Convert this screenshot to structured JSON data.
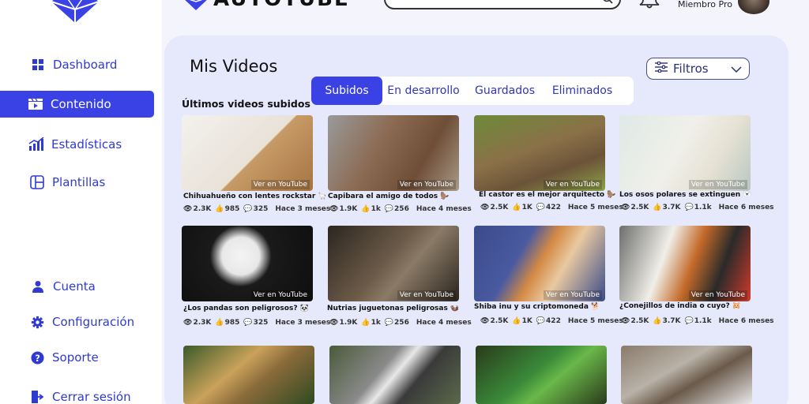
{
  "app": {
    "brand": "AUTOTUBE",
    "member_label": "Miembro Pro"
  },
  "sidebar": {
    "items": [
      {
        "label": "Dashboard",
        "icon": "grid-icon"
      },
      {
        "label": "Contenido",
        "icon": "clapperboard-icon",
        "active": true
      },
      {
        "label": "Estadísticas",
        "icon": "bar-chart-icon"
      },
      {
        "label": "Plantillas",
        "icon": "template-icon"
      }
    ],
    "bottom_items": [
      {
        "label": "Cuenta",
        "icon": "user-icon"
      },
      {
        "label": "Configuración",
        "icon": "gear-icon"
      },
      {
        "label": "Soporte",
        "icon": "help-icon"
      },
      {
        "label": "Cerrar sesión",
        "icon": "logout-icon"
      }
    ]
  },
  "main": {
    "title": "Mis Videos",
    "filter_label": "Filtros",
    "tabs": [
      {
        "label": "Subidos",
        "active": true
      },
      {
        "label": "En desarrollo"
      },
      {
        "label": "Guardados"
      },
      {
        "label": "Eliminados"
      }
    ],
    "section_title": "Últimos videos subidos",
    "view_label": "Ver en YouTube",
    "videos": [
      {
        "title": "Chihuahueño con lentes rockstar 🦙",
        "views": "2.3K",
        "likes": "985",
        "comments": "325",
        "ago": "Hace 3 meses"
      },
      {
        "title": "Capibara el amigo de todos 🦫",
        "views": "1.9K",
        "likes": "1k",
        "comments": "256",
        "ago": "Hace 4 meses"
      },
      {
        "title": "El castor es el mejor arquitecto 🦫",
        "views": "2.5K",
        "likes": "1K",
        "comments": "422",
        "ago": "Hace 5 meses"
      },
      {
        "title": "Los osos polares se extinguen 🐻‍❄️",
        "views": "2.5K",
        "likes": "3.7K",
        "comments": "1.1k",
        "ago": "Hace 6 meses"
      },
      {
        "title": "¿Los pandas son peligrosos? 🐼",
        "views": "2.3K",
        "likes": "985",
        "comments": "325",
        "ago": "Hace 3 meses"
      },
      {
        "title": "Nutrias juguetonas peligrosas 🦦",
        "views": "1.9K",
        "likes": "1k",
        "comments": "256",
        "ago": "Hace 4 meses"
      },
      {
        "title": "Shiba inu y su criptomoneda 🐕",
        "views": "2.5K",
        "likes": "1K",
        "comments": "422",
        "ago": "Hace 5 meses"
      },
      {
        "title": "¿Conejillos de india o cuyo? 🐹",
        "views": "2.5K",
        "likes": "3.7K",
        "comments": "1.1k",
        "ago": "Hace 6 meses"
      }
    ]
  },
  "colors": {
    "accent": "#3a42e6",
    "panel": "#e6e8fb"
  }
}
